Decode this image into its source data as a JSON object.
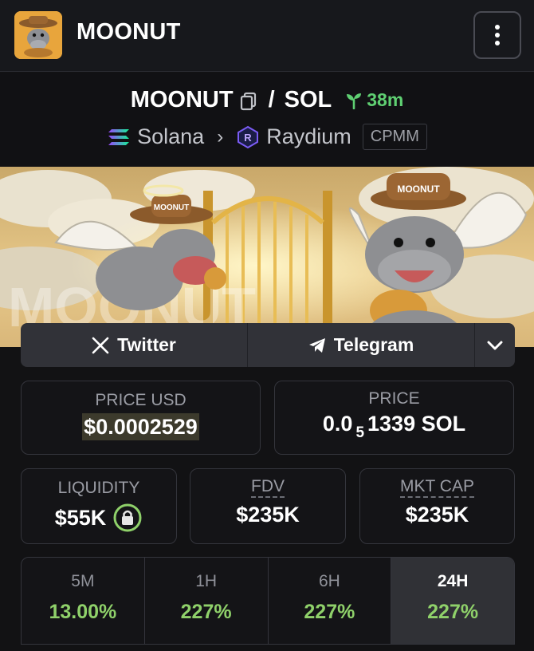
{
  "header": {
    "title": "MOONUT",
    "logo_icon": "hippo-cowboy-logo",
    "menu_icon": "kebab-menu-icon"
  },
  "pair": {
    "base": "MOONUT",
    "separator": "/",
    "quote": "SOL",
    "age": "38m",
    "chain": "Solana",
    "dex": "Raydium",
    "pool_type": "CPMM",
    "age_color": "#5fcf72"
  },
  "banner": {
    "watermark": "MOONUT",
    "hat_text": "MOONUT"
  },
  "socials": {
    "twitter_label": "Twitter",
    "telegram_label": "Telegram"
  },
  "stats": {
    "price_usd_label": "PRICE USD",
    "price_usd_value": "$0.0002529",
    "price_label": "PRICE",
    "price_prefix": "0.0",
    "price_sub": "5",
    "price_digits": "1339 SOL",
    "liquidity_label": "LIQUIDITY",
    "liquidity_value": "$55K",
    "fdv_label": "FDV",
    "fdv_value": "$235K",
    "mktcap_label": "MKT CAP",
    "mktcap_value": "$235K"
  },
  "timeframes": [
    {
      "label": "5M",
      "value": "13.00%"
    },
    {
      "label": "1H",
      "value": "227%"
    },
    {
      "label": "6H",
      "value": "227%"
    },
    {
      "label": "24H",
      "value": "227%"
    }
  ],
  "colors": {
    "positive": "#8fd16a",
    "accent_green": "#5fcf72",
    "background": "#121214"
  }
}
